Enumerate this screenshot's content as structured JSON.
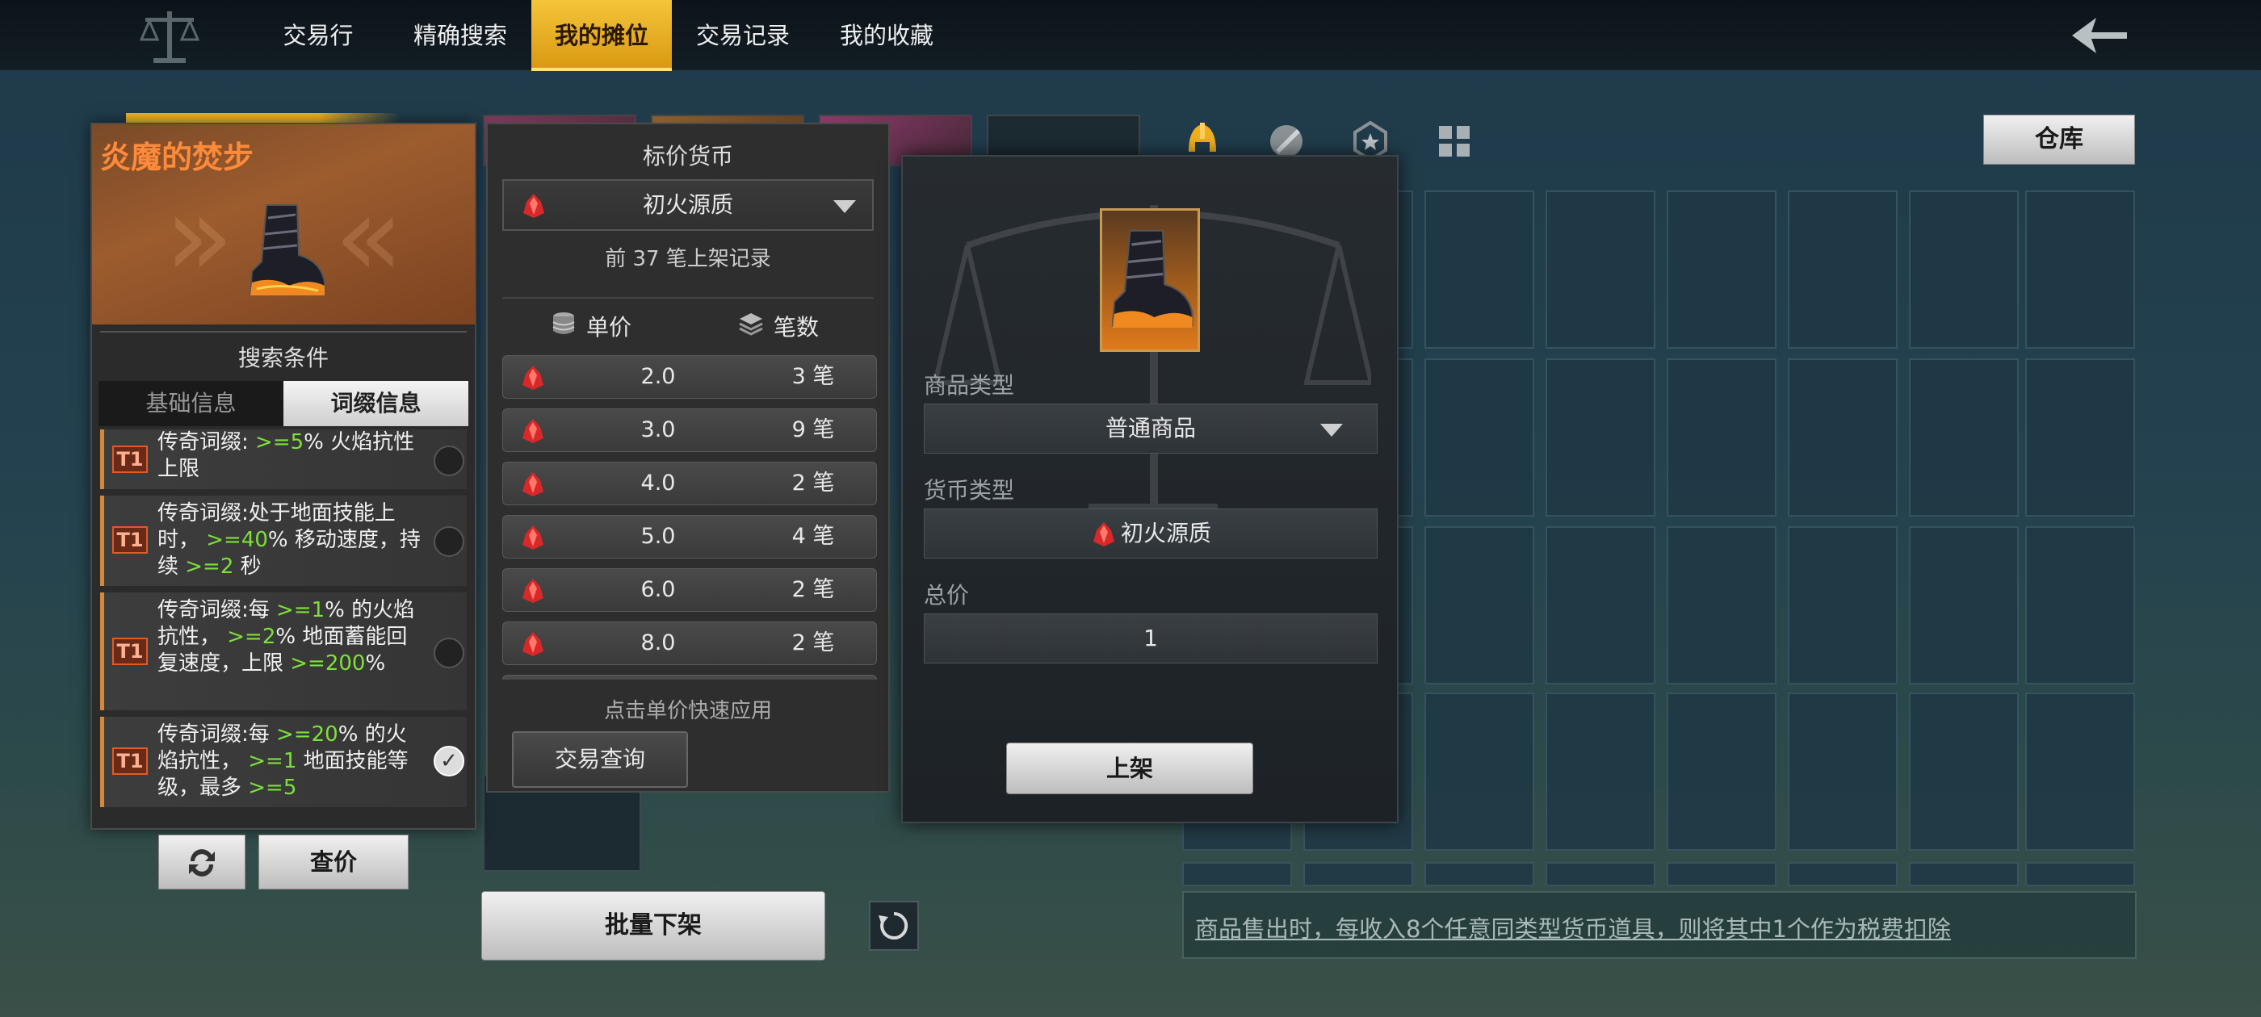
{
  "nav": {
    "tabs": [
      {
        "label": "交易行"
      },
      {
        "label": "精确搜索"
      },
      {
        "label": "我的摊位"
      },
      {
        "label": "交易记录"
      },
      {
        "label": "我的收藏"
      }
    ],
    "active_tab": "我的摊位"
  },
  "item_panel": {
    "item_name": "炎魔的焚步",
    "search_title": "搜索条件",
    "tabs": [
      "基础信息",
      "词缀信息"
    ],
    "active_tab": "词缀信息",
    "affixes": [
      {
        "tier": "T1",
        "p1": "传奇词缀: ",
        "g1": ">=5",
        "p2": "% 火焰抗性上限",
        "checked": false
      },
      {
        "tier": "T1",
        "p1": "传奇词缀:处于地面技能上时， ",
        "g1": ">=40",
        "p2": "% 移动速度，持续 ",
        "g2": ">=2",
        "p3": " 秒",
        "checked": false
      },
      {
        "tier": "T1",
        "p1": "传奇词缀:每 ",
        "g1": ">=1",
        "p2": "% 的火焰抗性， ",
        "g2": ">=2",
        "p3": "% 地面蓄能回复速度，上限 ",
        "g3": ">=200",
        "p4": "%",
        "checked": false
      },
      {
        "tier": "T1",
        "p1": "传奇词缀:每 ",
        "g1": ">=20",
        "p2": "% 的火焰抗性， ",
        "g2": ">=1",
        "p3": " 地面技能等级，最多 ",
        "g3": ">=5",
        "checked": true
      }
    ],
    "check_price_label": "查价"
  },
  "price_panel": {
    "title": "标价货币",
    "currency": "初火源质",
    "records_note": "前 37 笔上架记录",
    "col_unit_price": "单价",
    "col_count": "笔数",
    "rows": [
      {
        "price": "2.0",
        "count": "3 笔"
      },
      {
        "price": "3.0",
        "count": "9 笔"
      },
      {
        "price": "4.0",
        "count": "2 笔"
      },
      {
        "price": "5.0",
        "count": "4 笔"
      },
      {
        "price": "6.0",
        "count": "2 笔"
      },
      {
        "price": "8.0",
        "count": "2 笔"
      }
    ],
    "hint": "点击单价快速应用",
    "trade_query_label": "交易查询"
  },
  "listing_panel": {
    "goods_type_label": "商品类型",
    "goods_type_value": "普通商品",
    "currency_type_label": "货币类型",
    "currency_type_value": "初火源质",
    "total_price_label": "总价",
    "total_price_value": "1",
    "list_button_label": "上架"
  },
  "warehouse_label": "仓库",
  "batch_delist_label": "批量下架",
  "tax_note": "商品售出时，每收入8个任意同类型货币道具，则将其中1个作为税费扣除",
  "colors": {
    "accent": "#e8aa22",
    "item_name": "#ff8a3a",
    "affix_value": "#7ee03a",
    "tier_badge": "#e05a2a"
  }
}
